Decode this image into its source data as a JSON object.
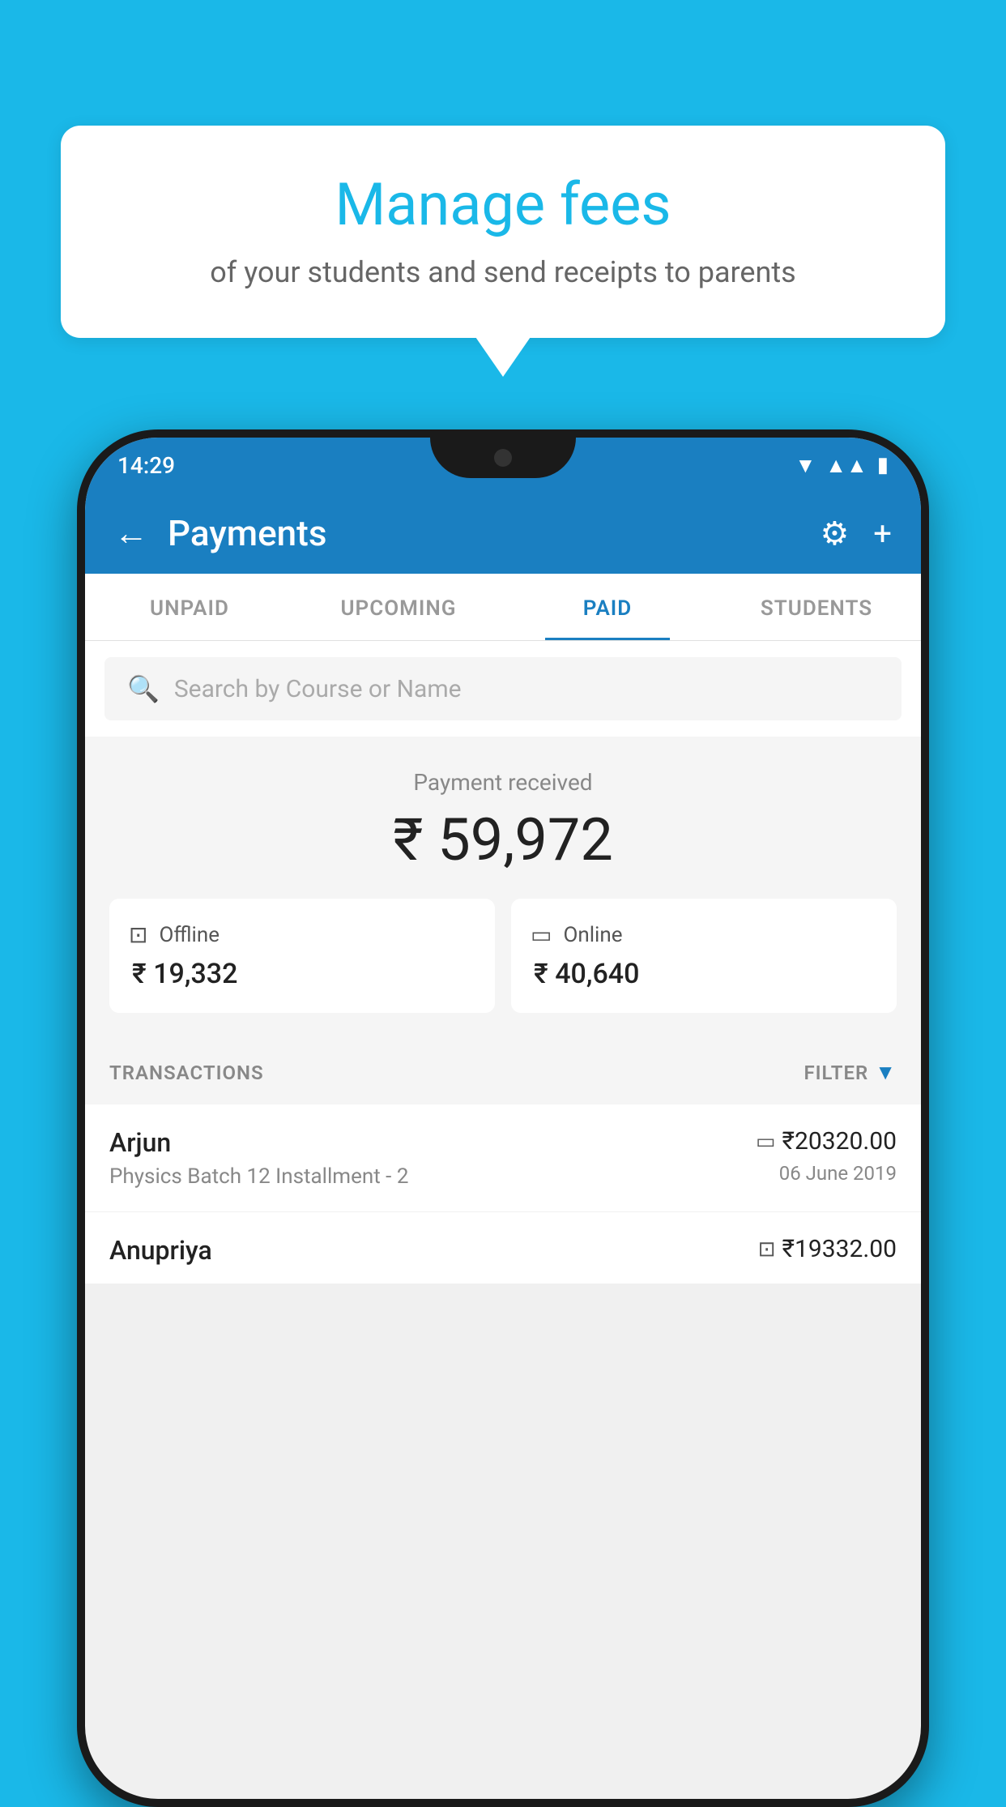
{
  "background_color": "#1ab8e8",
  "speech_bubble": {
    "title": "Manage fees",
    "subtitle": "of your students and send receipts to parents"
  },
  "status_bar": {
    "time": "14:29",
    "wifi_icon": "▼",
    "signal_icon": "▲",
    "battery_icon": "▮"
  },
  "app_header": {
    "title": "Payments",
    "back_label": "←",
    "settings_label": "⚙",
    "add_label": "+"
  },
  "tabs": [
    {
      "label": "UNPAID",
      "active": false
    },
    {
      "label": "UPCOMING",
      "active": false
    },
    {
      "label": "PAID",
      "active": true
    },
    {
      "label": "STUDENTS",
      "active": false
    }
  ],
  "search": {
    "placeholder": "Search by Course or Name"
  },
  "payment_summary": {
    "label": "Payment received",
    "amount": "₹ 59,972",
    "offline": {
      "label": "Offline",
      "amount": "₹ 19,332"
    },
    "online": {
      "label": "Online",
      "amount": "₹ 40,640"
    }
  },
  "transactions_section": {
    "label": "TRANSACTIONS",
    "filter_label": "FILTER"
  },
  "transactions": [
    {
      "name": "Arjun",
      "detail": "Physics Batch 12 Installment - 2",
      "amount": "₹20320.00",
      "date": "06 June 2019",
      "payment_type": "card"
    },
    {
      "name": "Anupriya",
      "detail": "",
      "amount": "₹19332.00",
      "date": "",
      "payment_type": "offline"
    }
  ]
}
